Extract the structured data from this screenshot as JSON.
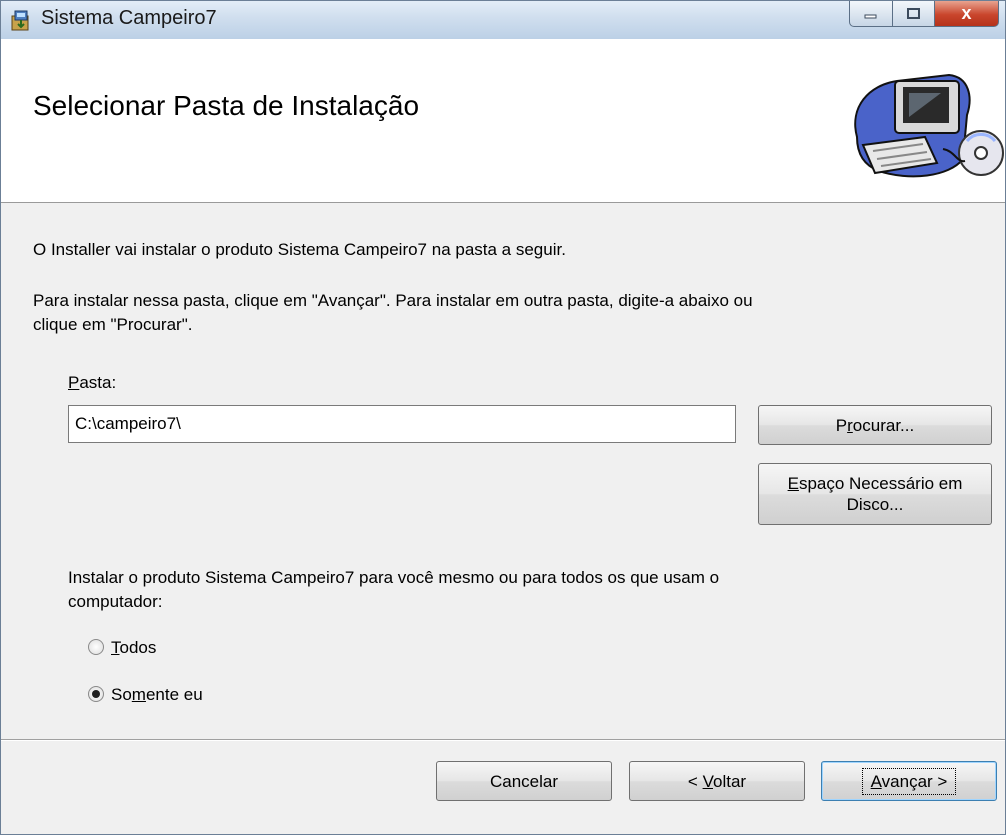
{
  "window": {
    "title": "Sistema  Campeiro7",
    "app_icon": "installer-icon",
    "caption_buttons": [
      "minimize-icon",
      "maximize-icon",
      "close-icon"
    ],
    "close_glyph": "x"
  },
  "header": {
    "title": "Selecionar Pasta de Instalação",
    "graphic": "computer-disc-icon"
  },
  "content": {
    "intro": "O Installer vai instalar o produto Sistema  Campeiro7 na pasta a seguir.",
    "instructions_line1": "Para instalar nessa pasta, clique em \"Avançar\". Para instalar em outra pasta, digite-a abaixo ou",
    "instructions_line2": "clique em \"Procurar\".",
    "folder_label_accel": "P",
    "folder_label_rest": "asta:",
    "folder_value": "C:\\campeiro7\\",
    "browse_button": {
      "pre": "P",
      "accel": "r",
      "post": "ocurar..."
    },
    "disk_space_button": {
      "accel": "E",
      "line1_rest": "spaço Necessário em",
      "line2": "Disco..."
    },
    "install_for_line1": "Instalar o produto Sistema  Campeiro7 para você mesmo ou para todos os que usam o",
    "install_for_line2": "computador:",
    "radio_all": {
      "accel": "T",
      "rest": "odos",
      "selected": false
    },
    "radio_me": {
      "pre": "So",
      "accel": "m",
      "post": "ente eu",
      "selected": true
    }
  },
  "footer": {
    "cancel": "Cancelar",
    "back": {
      "pre": "< ",
      "accel": "V",
      "post": "oltar"
    },
    "next": {
      "accel": "A",
      "post": "vançar >"
    }
  },
  "colors": {
    "titlebar": "#cfdeee",
    "close_button": "#c9452c",
    "header_bg": "#ffffff",
    "dialog_bg": "#f0f0f0"
  }
}
